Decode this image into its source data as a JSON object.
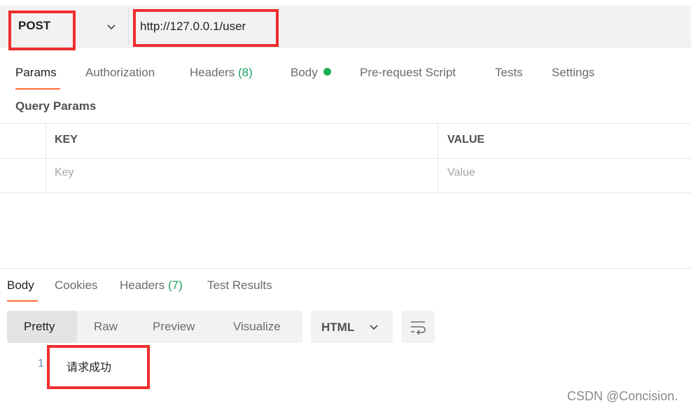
{
  "request": {
    "method": "POST",
    "url": "http://127.0.0.1/user"
  },
  "request_tabs": [
    {
      "label": "Params",
      "active": true
    },
    {
      "label": "Authorization"
    },
    {
      "label": "Headers",
      "count": "(8)"
    },
    {
      "label": "Body",
      "indicator": "green-dot"
    },
    {
      "label": "Pre-request Script"
    },
    {
      "label": "Tests"
    },
    {
      "label": "Settings"
    }
  ],
  "query_params": {
    "title": "Query Params",
    "columns": [
      "KEY",
      "VALUE"
    ],
    "placeholders": {
      "key": "Key",
      "value": "Value"
    }
  },
  "response_tabs": [
    {
      "label": "Body",
      "active": true
    },
    {
      "label": "Cookies"
    },
    {
      "label": "Headers",
      "count": "(7)"
    },
    {
      "label": "Test Results"
    }
  ],
  "view_modes": [
    {
      "label": "Pretty",
      "active": true
    },
    {
      "label": "Raw"
    },
    {
      "label": "Preview"
    },
    {
      "label": "Visualize"
    }
  ],
  "format": {
    "selected": "HTML"
  },
  "response_body": {
    "line_number": "1",
    "text": "请求成功"
  },
  "watermark": "CSDN @Concision.",
  "colors": {
    "accent": "#ff6c37",
    "highlight": "#f02d2d",
    "success": "#1c9f63"
  },
  "icons": [
    "chevron-down-icon",
    "wrap-lines-icon",
    "status-dot-icon"
  ]
}
